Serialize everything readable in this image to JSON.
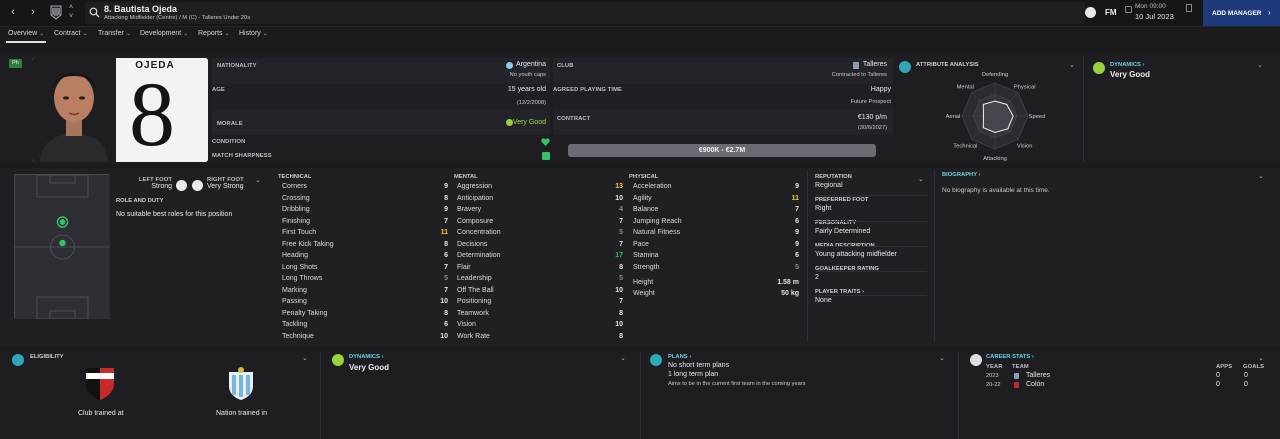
{
  "header": {
    "player_name": "8. Bautista Ojeda",
    "subtitle": "Attacking Midfielder (Centre) / M (C) - Talleres Under 20s",
    "game_logo": "FM",
    "time": "Mon 09:00",
    "date": "10 Jul 2023",
    "add_manager": "ADD MANAGER"
  },
  "tabs": [
    {
      "label": "Overview"
    },
    {
      "label": "Contract"
    },
    {
      "label": "Transfer"
    },
    {
      "label": "Development"
    },
    {
      "label": "Reports"
    },
    {
      "label": "History"
    }
  ],
  "profile": {
    "badge": "Ph",
    "shirt_name": "OJEDA",
    "shirt_number": "8",
    "nationality_label": "NATIONALITY",
    "nationality": "Argentina",
    "youth_caps": "No youth caps",
    "age_label": "AGE",
    "age": "15 years old",
    "dob": "(12/2/2008)",
    "morale_label": "MORALE",
    "morale": "Very Good",
    "condition_label": "CONDITION",
    "sharpness_label": "MATCH SHARPNESS",
    "club_label": "CLUB",
    "club": "Talleres",
    "club_status": "Contracted to Talleres",
    "playing_time_label": "AGREED PLAYING TIME",
    "playing_time_1": "Happy",
    "playing_time_2": "Future Prospect",
    "contract_label": "CONTRACT",
    "wage": "€130 p/m",
    "expires": "(30/6/2027)",
    "value_range": "€900K - €2.7M"
  },
  "attribute_analysis": {
    "title": "ATTRIBUTE ANALYSIS",
    "axes": [
      "Defending",
      "Physical",
      "Speed",
      "Vision",
      "Attacking",
      "Technical",
      "Aerial",
      "Mental"
    ],
    "values": [
      0.45,
      0.5,
      0.55,
      0.55,
      0.5,
      0.5,
      0.35,
      0.5
    ]
  },
  "dynamics_top": {
    "title": "DYNAMICS",
    "value": "Very Good"
  },
  "feet": {
    "left_label": "LEFT FOOT",
    "left_value": "Strong",
    "right_label": "RIGHT FOOT",
    "right_value": "Very Strong"
  },
  "role": {
    "title": "ROLE AND DUTY",
    "text": "No suitable best roles for this position"
  },
  "technical": {
    "title": "TECHNICAL",
    "rows": [
      {
        "name": "Corners",
        "value": "9",
        "cls": ""
      },
      {
        "name": "Crossing",
        "value": "8",
        "cls": ""
      },
      {
        "name": "Dribbling",
        "value": "9",
        "cls": ""
      },
      {
        "name": "Finishing",
        "value": "7",
        "cls": ""
      },
      {
        "name": "First Touch",
        "value": "11",
        "cls": "hi"
      },
      {
        "name": "Free Kick Taking",
        "value": "8",
        "cls": ""
      },
      {
        "name": "Heading",
        "value": "6",
        "cls": ""
      },
      {
        "name": "Long Shots",
        "value": "7",
        "cls": ""
      },
      {
        "name": "Long Throws",
        "value": "5",
        "cls": "dim"
      },
      {
        "name": "Marking",
        "value": "7",
        "cls": ""
      },
      {
        "name": "Passing",
        "value": "10",
        "cls": ""
      },
      {
        "name": "Penalty Taking",
        "value": "8",
        "cls": ""
      },
      {
        "name": "Tackling",
        "value": "6",
        "cls": ""
      },
      {
        "name": "Technique",
        "value": "10",
        "cls": ""
      }
    ]
  },
  "mental": {
    "title": "MENTAL",
    "rows": [
      {
        "name": "Aggression",
        "value": "13",
        "cls": "hi"
      },
      {
        "name": "Anticipation",
        "value": "10",
        "cls": ""
      },
      {
        "name": "Bravery",
        "value": "4",
        "cls": "dim"
      },
      {
        "name": "Composure",
        "value": "7",
        "cls": ""
      },
      {
        "name": "Concentration",
        "value": "5",
        "cls": "dim"
      },
      {
        "name": "Decisions",
        "value": "7",
        "cls": ""
      },
      {
        "name": "Determination",
        "value": "17",
        "cls": "gr"
      },
      {
        "name": "Flair",
        "value": "8",
        "cls": ""
      },
      {
        "name": "Leadership",
        "value": "5",
        "cls": "dim"
      },
      {
        "name": "Off The Ball",
        "value": "10",
        "cls": ""
      },
      {
        "name": "Positioning",
        "value": "7",
        "cls": ""
      },
      {
        "name": "Teamwork",
        "value": "8",
        "cls": ""
      },
      {
        "name": "Vision",
        "value": "10",
        "cls": ""
      },
      {
        "name": "Work Rate",
        "value": "8",
        "cls": ""
      }
    ]
  },
  "physical": {
    "title": "PHYSICAL",
    "rows": [
      {
        "name": "Acceleration",
        "value": "9",
        "cls": ""
      },
      {
        "name": "Agility",
        "value": "11",
        "cls": "hi"
      },
      {
        "name": "Balance",
        "value": "7",
        "cls": ""
      },
      {
        "name": "Jumping Reach",
        "value": "6",
        "cls": ""
      },
      {
        "name": "Natural Fitness",
        "value": "9",
        "cls": ""
      },
      {
        "name": "Pace",
        "value": "9",
        "cls": ""
      },
      {
        "name": "Stamina",
        "value": "6",
        "cls": ""
      },
      {
        "name": "Strength",
        "value": "5",
        "cls": "dim"
      }
    ],
    "height_label": "Height",
    "height": "1.58 m",
    "weight_label": "Weight",
    "weight": "50 kg"
  },
  "info": {
    "reputation_label": "REPUTATION",
    "reputation": "Regional",
    "foot_label": "PREFERRED FOOT",
    "foot": "Right",
    "personality_label": "PERSONALITY",
    "personality": "Fairly Determined",
    "media_label": "MEDIA DESCRIPTION",
    "media": "Young attacking midfielder",
    "gk_label": "GOALKEEPER RATING",
    "gk": "2",
    "traits_label": "PLAYER TRAITS",
    "traits": "None"
  },
  "biography": {
    "title": "BIOGRAPHY",
    "text": "No biography is available at this time."
  },
  "eligibility": {
    "title": "ELIGIBILITY",
    "club_label": "Club trained at",
    "nation_label": "Nation trained in"
  },
  "dynamics_bottom": {
    "title": "DYNAMICS",
    "value": "Very Good"
  },
  "plans": {
    "title": "PLANS",
    "line1": "No short term plans",
    "line2": "1 long term plan",
    "line3": "Aims to be in the current first team in the coming years"
  },
  "career": {
    "title": "CAREER STATS",
    "col_year": "YEAR",
    "col_team": "TEAM",
    "col_apps": "APPS",
    "col_goals": "GOALS",
    "rows": [
      {
        "year": "2023",
        "team": "Talleres",
        "apps": "0",
        "goals": "0"
      },
      {
        "year": "20-22",
        "team": "Colón",
        "apps": "0",
        "goals": "0"
      }
    ]
  },
  "colors": {
    "accent_green": "#33c26a",
    "highlight_yellow": "#e6d33a",
    "cyan": "#6fd2e0",
    "add_manager_bg": "#1e3a7a"
  }
}
